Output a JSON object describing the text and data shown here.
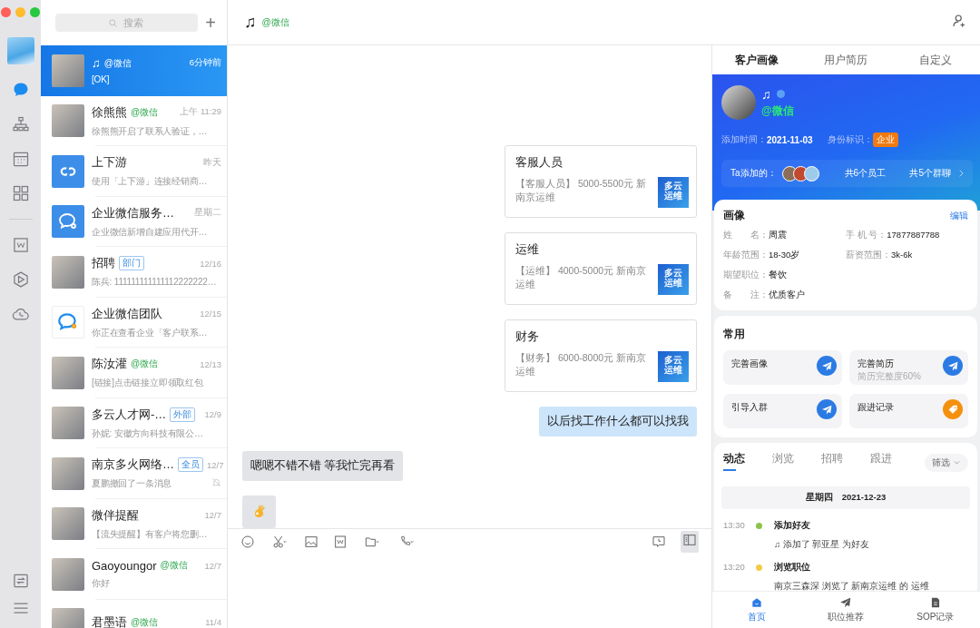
{
  "rail": {
    "top": [
      {
        "kind": "chat",
        "selected": true
      },
      {
        "kind": "org",
        "selected": false
      },
      {
        "kind": "calendar",
        "selected": false
      },
      {
        "kind": "apps",
        "selected": false
      },
      {
        "kind": "doc",
        "selected": false
      },
      {
        "kind": "hexagon",
        "selected": false
      },
      {
        "kind": "cloud",
        "selected": false
      }
    ],
    "bottom": [
      {
        "kind": "swap",
        "selected": false
      },
      {
        "kind": "menu",
        "selected": false
      }
    ]
  },
  "search": {
    "placeholder": "搜索",
    "add": "+"
  },
  "chats": [
    {
      "kind": "photo",
      "name": "♫",
      "tag": {
        "text": "@微信",
        "kind": "wechat"
      },
      "time": "6分钟前",
      "preview": "[OK]",
      "selected": true,
      "muted": false
    },
    {
      "kind": "photo",
      "name": "徐熊熊",
      "tag": {
        "text": "@微信",
        "kind": "wechat"
      },
      "time": "上午 11:29",
      "preview": "徐熊熊开启了联系人验证，…",
      "selected": false,
      "muted": false
    },
    {
      "kind": "link-app",
      "name": "上下游",
      "time": "昨天",
      "preview": "使用「上下游」连接经销商…",
      "selected": false,
      "muted": false
    },
    {
      "kind": "chat-app",
      "name": "企业微信服务…",
      "time": "星期二",
      "preview": "企业微信新增自建应用代开…",
      "selected": false,
      "muted": false
    },
    {
      "kind": "photo",
      "name": "招聘",
      "tag": {
        "text": "部门",
        "kind": "label"
      },
      "time": "12/16",
      "preview": "陈兵: 111111111111112222222…",
      "selected": false,
      "muted": false
    },
    {
      "kind": "team-app",
      "name": "企业微信团队",
      "time": "12/15",
      "preview": "你正在查看企业「客户联系…",
      "selected": false,
      "muted": false
    },
    {
      "kind": "photo",
      "name": "陈汝灌",
      "tag": {
        "text": "@微信",
        "kind": "wechat"
      },
      "time": "12/13",
      "preview": "[链接]点击链接立即领取红包",
      "selected": false,
      "muted": false
    },
    {
      "kind": "photo",
      "name": "多云人才网-…",
      "tag": {
        "text": "外部",
        "kind": "label"
      },
      "time": "12/9",
      "preview": "孙妮: 安徽方向科技有限公…",
      "selected": false,
      "muted": false
    },
    {
      "kind": "photo",
      "name": "南京多火网络…",
      "tag": {
        "text": "全员",
        "kind": "label"
      },
      "time": "12/7",
      "preview": "夏鹏撤回了一条消息",
      "selected": false,
      "muted": true
    },
    {
      "kind": "photo",
      "name": "微伴提醒",
      "time": "12/7",
      "preview": "【流失提醒】有客户将您删…",
      "selected": false,
      "muted": false
    },
    {
      "kind": "photo",
      "name": "Gaoyoungor",
      "tag": {
        "text": "@微信",
        "kind": "wechat"
      },
      "time": "12/7",
      "preview": "你好",
      "selected": false,
      "muted": false
    },
    {
      "kind": "photo",
      "name": "君墨语",
      "tag": {
        "text": "@微信",
        "kind": "wechat"
      },
      "time": "11/4",
      "selected": false,
      "muted": false
    }
  ],
  "header": {
    "name": "♫",
    "tag": "@微信"
  },
  "messages": [
    {
      "kind": "card",
      "sent": true,
      "title": "客服人员",
      "body": "【客服人员】 5000-5500元 新南京运维",
      "thumb": "多云运维"
    },
    {
      "kind": "card",
      "sent": true,
      "title": "运维",
      "body": "【运维】 4000-5000元 新南京运维",
      "thumb": "多云运维"
    },
    {
      "kind": "card",
      "sent": true,
      "title": "财务",
      "body": "【财务】 6000-8000元 新南京运维",
      "thumb": "多云运维"
    },
    {
      "kind": "text",
      "sent": true,
      "text": "以后找工作什么都可以找我"
    },
    {
      "kind": "text",
      "sent": false,
      "text": "嗯嗯不错不错 等我忙完再看"
    },
    {
      "kind": "sticker",
      "sent": false
    }
  ],
  "panel": {
    "tabs": [
      {
        "label": "客户画像",
        "selected": true
      },
      {
        "label": "用户简历",
        "selected": false
      },
      {
        "label": "自定义",
        "selected": false
      }
    ],
    "profile": {
      "name": "♫",
      "tag": "@微信",
      "added_label": "添加时间：",
      "added": "2021-11-03",
      "identity_label": "身份标识：",
      "identity": "企业",
      "added_by_label": "Ta添加的：",
      "staff": "共6个员工",
      "groups": "共5个群聊"
    },
    "portrait": {
      "title": "画像",
      "edit": "编辑",
      "rows": [
        [
          {
            "label": "姓　　名：",
            "value": "周震"
          },
          {
            "label": "手 机 号：",
            "value": "17877887788"
          }
        ],
        [
          {
            "label": "年龄范围：",
            "value": "18-30岁"
          },
          {
            "label": "薪资范围：",
            "value": "3k-6k"
          }
        ],
        [
          {
            "label": "期望职位：",
            "value": "餐饮"
          }
        ],
        [
          {
            "label": "备　　注：",
            "value": "优质客户"
          }
        ]
      ]
    },
    "common": {
      "title": "常用",
      "actions": [
        {
          "label": "完善画像",
          "kind": "send"
        },
        {
          "label": "完善简历",
          "sub": "简历完整度60%",
          "kind": "send"
        },
        {
          "label": "引导入群",
          "kind": "send"
        },
        {
          "label": "跟进记录",
          "kind": "tag"
        }
      ]
    },
    "activity": {
      "tabs": [
        {
          "label": "动态",
          "selected": true
        },
        {
          "label": "浏览",
          "selected": false
        },
        {
          "label": "招聘",
          "selected": false
        },
        {
          "label": "跟进",
          "selected": false
        }
      ],
      "filter": "筛选",
      "date": "星期四　2021-12-23",
      "events": [
        {
          "time": "13:30",
          "title": "添加好友",
          "text": "♫ 添加了 郭亚星 为好友",
          "color": "#8bc34a"
        },
        {
          "time": "13:20",
          "title": "浏览职位",
          "text": "南京三森深 浏览了 新南京运维 的 运维",
          "color": "#f0cc45"
        }
      ]
    },
    "nav": [
      {
        "label": "首页",
        "kind": "home",
        "selected": true
      },
      {
        "label": "职位推荐",
        "kind": "send",
        "selected": false
      },
      {
        "label": "SOP记录",
        "kind": "doc",
        "selected": false
      }
    ]
  }
}
